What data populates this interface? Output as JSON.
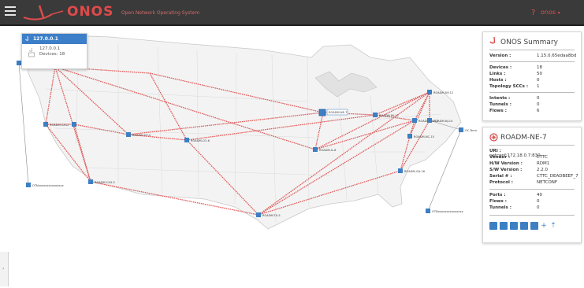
{
  "app": {
    "logo_text": "ONOS",
    "subtitle": "Open Network Operating System",
    "help": "?",
    "user": "onos",
    "user_caret": "▾"
  },
  "instance_panel": {
    "title": "127.0.0.1",
    "ip": "127.0.0.1",
    "devices": "Devices: 18"
  },
  "summary": {
    "title": "ONOS Summary",
    "rows": [
      {
        "k": "Version :",
        "v": "1.15.0.65edaa8bd"
      },
      {
        "k": "Devices :",
        "v": "18"
      },
      {
        "k": "Links :",
        "v": "50"
      },
      {
        "k": "Hosts :",
        "v": "0"
      },
      {
        "k": "Topology SCCs :",
        "v": "1"
      },
      {
        "k": "Intents :",
        "v": "0"
      },
      {
        "k": "Tunnels :",
        "v": "0"
      },
      {
        "k": "Flows :",
        "v": "6"
      }
    ]
  },
  "device": {
    "title": "ROADM-NE-7",
    "rows": [
      {
        "k": "URI :",
        "v": "netconf:172.18.0.7:830"
      },
      {
        "k": "Vendor :",
        "v": "CTTC"
      },
      {
        "k": "H/W Version :",
        "v": "RDM1"
      },
      {
        "k": "S/W Version :",
        "v": "2.2.0"
      },
      {
        "k": "Serial # :",
        "v": "CTTC_DEADBEEF_7"
      },
      {
        "k": "Protocol :",
        "v": "NETCONF"
      },
      {
        "k": "Ports :",
        "v": "40"
      },
      {
        "k": "Flows :",
        "v": "0"
      },
      {
        "k": "Tunnels :",
        "v": "0"
      }
    ]
  },
  "map": {
    "link_color": "#e05c5c",
    "node_color": "#3d7fc3",
    "nodes": [
      {
        "id": "roadm-ca12",
        "label": "ROADM-CA12"
      },
      {
        "id": "roadm-ut4",
        "label": "ROADM-UT-4"
      },
      {
        "id": "roadm-co6",
        "label": "ROADM-CO-6"
      },
      {
        "id": "roadm-ca3",
        "label": "ROADM-CA3-3"
      },
      {
        "id": "roadm-tx5",
        "label": "ROADM-TX-5"
      },
      {
        "id": "roadm-il8",
        "label": "ROADM-IL-8"
      },
      {
        "id": "roadm-ne7",
        "label": "ROADM-NE-7"
      },
      {
        "id": "roadm-mi11",
        "label": "ROADM-MI-11"
      },
      {
        "id": "roadm-ny12",
        "label": "ROADM-NY-12"
      },
      {
        "id": "roadm-va13",
        "label": "ROADM-VA-13"
      },
      {
        "id": "roadm-nj14",
        "label": "ROADM-NJ-14"
      },
      {
        "id": "roadm-nc15",
        "label": "ROADM-NC-15"
      },
      {
        "id": "roadm-ga16",
        "label": "ROADM-GA-16"
      },
      {
        "id": "oc-term",
        "label": "OC-Term"
      },
      {
        "id": "wa-w",
        "label": ""
      },
      {
        "id": "otn-w",
        "label": "OTNxxxxxxxxxxxxxxx"
      },
      {
        "id": "otn-e",
        "label": "OTNxxxxxxxxxxxxxxx"
      }
    ]
  },
  "side_toggle": "›"
}
